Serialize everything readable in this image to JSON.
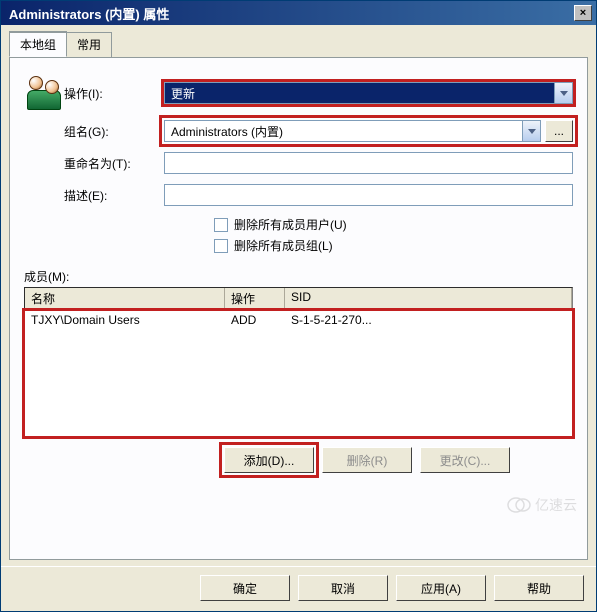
{
  "window": {
    "title": "Administrators (内置) 属性",
    "close_label": "×"
  },
  "tabs": {
    "t0": "本地组",
    "t1": "常用"
  },
  "action": {
    "label": "操作(I):",
    "value": "更新"
  },
  "group_name": {
    "label": "组名(G):",
    "value": "Administrators (内置)",
    "browse": "..."
  },
  "rename": {
    "label": "重命名为(T):",
    "value": ""
  },
  "description": {
    "label": "描述(E):",
    "value": ""
  },
  "checks": {
    "del_users": "删除所有成员用户(U)",
    "del_groups": "删除所有成员组(L)"
  },
  "members": {
    "label": "成员(M):",
    "cols": {
      "name": "名称",
      "op": "操作",
      "sid": "SID"
    },
    "rows": [
      {
        "name": "TJXY\\Domain Users",
        "op": "ADD",
        "sid": "S-1-5-21-270..."
      }
    ]
  },
  "buttons": {
    "add": "添加(D)...",
    "remove": "删除(R)",
    "change": "更改(C)...",
    "ok": "确定",
    "cancel": "取消",
    "apply": "应用(A)",
    "help": "帮助"
  },
  "watermark": "亿速云"
}
